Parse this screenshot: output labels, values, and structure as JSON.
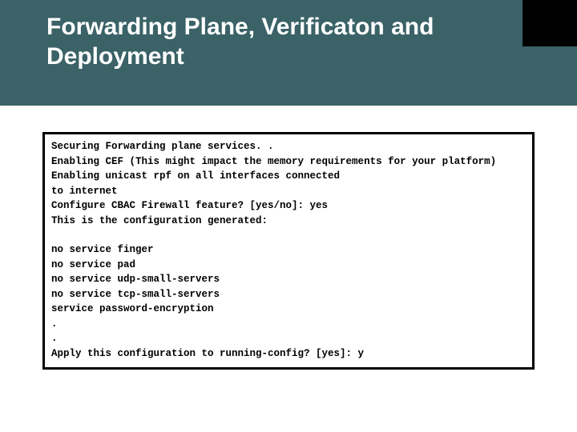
{
  "title": "Forwarding Plane, Verificaton and Deployment",
  "code": {
    "l1": "Securing Forwarding plane services. .",
    "l2": "Enabling CEF (This might impact the memory requirements for your platform)",
    "l3": "Enabling unicast rpf on all interfaces connected",
    "l4": "to internet",
    "l5": "Configure CBAC Firewall feature? [yes/no]: yes",
    "l6": "This is the configuration generated:",
    "l7": "no service finger",
    "l8": "no service pad",
    "l9": "no service udp-small-servers",
    "l10": "no service tcp-small-servers",
    "l11": "service password-encryption",
    "l12": ".",
    "l13": ".",
    "l14": "Apply this configuration to running-config? [yes]: y"
  }
}
